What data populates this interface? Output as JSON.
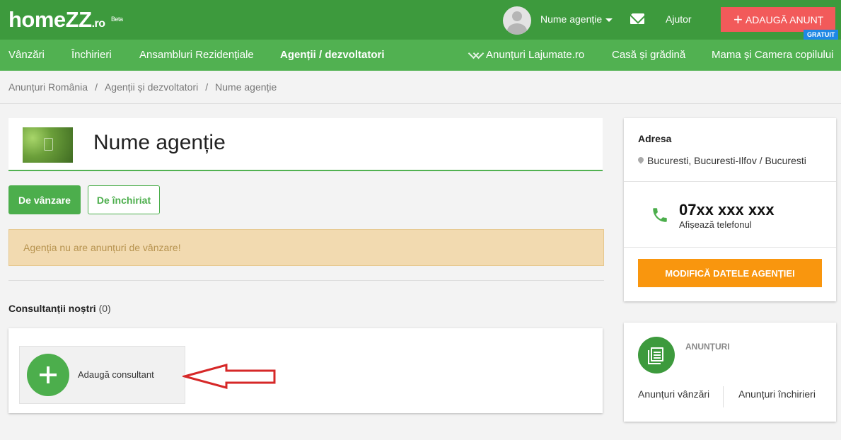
{
  "header": {
    "logo_main": "homeZZ",
    "logo_suffix": ".ro",
    "logo_badge": "Beta",
    "agency_menu": "Nume agenție",
    "help": "Ajutor",
    "add_listing": "ADAUGĂ ANUNȚ",
    "free_badge": "GRATUIT",
    "colors": {
      "primary": "#3d9a3d",
      "nav": "#51b151",
      "add_button": "#f25a5a",
      "badge": "#1e88e5"
    }
  },
  "nav": {
    "items": [
      {
        "label": "Vânzări"
      },
      {
        "label": "Închirieri"
      },
      {
        "label": "Ansambluri Rezidențiale"
      },
      {
        "label": "Agenții / dezvoltatori",
        "active": true
      },
      {
        "label": "Anunțuri Lajumate.ro",
        "icon": "handshake-icon"
      },
      {
        "label": "Casă și grădină"
      },
      {
        "label": "Mama și Camera copilului"
      }
    ]
  },
  "breadcrumb": {
    "items": [
      "Anunțuri România",
      "Agenții și dezvoltatori",
      "Nume agenție"
    ],
    "separator": "/"
  },
  "agency": {
    "name": "Nume agenție"
  },
  "tabs": {
    "sale": "De vânzare",
    "rent": "De închiriat"
  },
  "alert": {
    "message": "Agenția nu are anunțuri de vânzare!"
  },
  "consultants": {
    "title": "Consultanții noștri",
    "count": "(0)",
    "add_label": "Adaugă consultant"
  },
  "info": {
    "address_title": "Adresa",
    "address": "Bucuresti, Bucuresti-Ilfov / Bucuresti",
    "phone": "07xx xxx xxx",
    "phone_hint": "Afișează telefonul",
    "edit_button": "MODIFICĂ DATELE AGENȚIEI",
    "edit_color": "#f9960e"
  },
  "ads": {
    "title": "ANUNȚURI",
    "sale_link": "Anunțuri vânzări",
    "rent_link": "Anunțuri închirieri"
  }
}
